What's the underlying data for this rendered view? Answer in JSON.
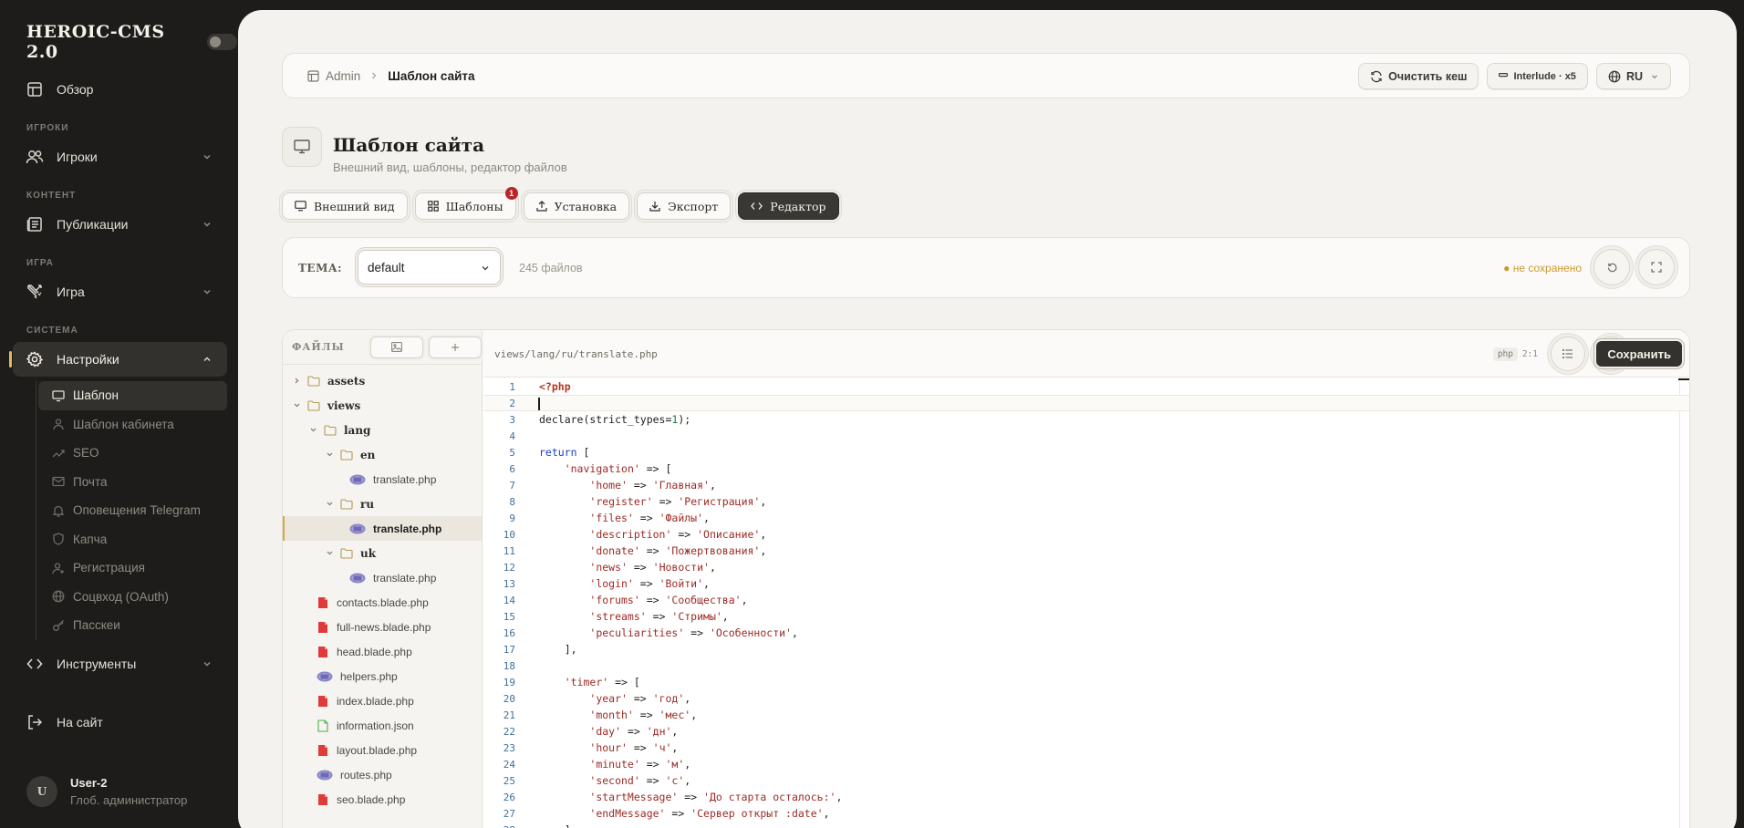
{
  "sidebar": {
    "logo": "HEROIC-CMS 2.0",
    "overview": "Обзор",
    "sections": {
      "players": "ИГРОКИ",
      "content": "КОНТЕНТ",
      "game": "ИГРА",
      "system": "СИСТЕМА"
    },
    "players_item": "Игроки",
    "publications_item": "Публикации",
    "game_item": "Игра",
    "settings_item": "Настройки",
    "settings_sub": [
      "Шаблон",
      "Шаблон кабинета",
      "SEO",
      "Почта",
      "Оповещения Telegram",
      "Капча",
      "Регистрация",
      "Соцвход (OAuth)",
      "Пасскеи"
    ],
    "tools_item": "Инструменты",
    "to_site": "На сайт",
    "user": {
      "initial": "U",
      "name": "User-2",
      "role": "Глоб. администратор"
    }
  },
  "topbar": {
    "crumb_admin": "Admin",
    "crumb_current": "Шаблон сайта",
    "clear_cache": "Очистить кеш",
    "server": "Interlude · x5",
    "language": "RU"
  },
  "page": {
    "title": "Шаблон сайта",
    "subtitle": "Внешний вид, шаблоны, редактор файлов"
  },
  "tabs": {
    "appearance": "Внешний вид",
    "templates": "Шаблоны",
    "templates_badge": "1",
    "install": "Установка",
    "export": "Экспорт",
    "editor": "Редактор"
  },
  "theme_bar": {
    "label": "ТЕМА:",
    "selected": "default",
    "files_count": "245 файлов",
    "status": "● не сохранено"
  },
  "files": {
    "title": "ФАЙЛЫ",
    "tree": [
      {
        "name": "assets",
        "kind": "folder",
        "depth": 0,
        "open": false
      },
      {
        "name": "views",
        "kind": "folder",
        "depth": 0,
        "open": true
      },
      {
        "name": "lang",
        "kind": "folder",
        "depth": 1,
        "open": true
      },
      {
        "name": "en",
        "kind": "folder",
        "depth": 2,
        "open": true
      },
      {
        "name": "translate.php",
        "kind": "php",
        "depth": 3
      },
      {
        "name": "ru",
        "kind": "folder",
        "depth": 2,
        "open": true
      },
      {
        "name": "translate.php",
        "kind": "php",
        "depth": 3,
        "selected": true
      },
      {
        "name": "uk",
        "kind": "folder",
        "depth": 2,
        "open": true
      },
      {
        "name": "translate.php",
        "kind": "php",
        "depth": 3
      },
      {
        "name": "contacts.blade.php",
        "kind": "blade",
        "depth": 1
      },
      {
        "name": "full-news.blade.php",
        "kind": "blade",
        "depth": 1
      },
      {
        "name": "head.blade.php",
        "kind": "blade",
        "depth": 1
      },
      {
        "name": "helpers.php",
        "kind": "php",
        "depth": 1
      },
      {
        "name": "index.blade.php",
        "kind": "blade",
        "depth": 1
      },
      {
        "name": "information.json",
        "kind": "json",
        "depth": 1
      },
      {
        "name": "layout.blade.php",
        "kind": "blade",
        "depth": 1
      },
      {
        "name": "routes.php",
        "kind": "php",
        "depth": 1
      },
      {
        "name": "seo.blade.php",
        "kind": "blade",
        "depth": 1
      }
    ]
  },
  "editor": {
    "path": "views/lang/ru/translate.php",
    "language": "php",
    "cursor": "2:1",
    "save_label": "Сохранить",
    "current_line": 2,
    "lines": [
      [
        [
          "t-tag",
          "<?php"
        ]
      ],
      [],
      [
        [
          "t-fn",
          "declare(strict_types="
        ],
        [
          "t-num",
          "1"
        ],
        [
          "t-fn",
          ");"
        ]
      ],
      [],
      [
        [
          "t-kw",
          "return"
        ],
        [
          "t-fn",
          " ["
        ]
      ],
      [
        [
          "t-fn",
          "    "
        ],
        [
          "t-str",
          "'navigation'"
        ],
        [
          "t-fn",
          " => ["
        ]
      ],
      [
        [
          "t-fn",
          "        "
        ],
        [
          "t-str",
          "'home'"
        ],
        [
          "t-fn",
          " => "
        ],
        [
          "t-str",
          "'Главная'"
        ],
        [
          "t-fn",
          ","
        ]
      ],
      [
        [
          "t-fn",
          "        "
        ],
        [
          "t-str",
          "'register'"
        ],
        [
          "t-fn",
          " => "
        ],
        [
          "t-str",
          "'Регистрация'"
        ],
        [
          "t-fn",
          ","
        ]
      ],
      [
        [
          "t-fn",
          "        "
        ],
        [
          "t-str",
          "'files'"
        ],
        [
          "t-fn",
          " => "
        ],
        [
          "t-str",
          "'Файлы'"
        ],
        [
          "t-fn",
          ","
        ]
      ],
      [
        [
          "t-fn",
          "        "
        ],
        [
          "t-str",
          "'description'"
        ],
        [
          "t-fn",
          " => "
        ],
        [
          "t-str",
          "'Описание'"
        ],
        [
          "t-fn",
          ","
        ]
      ],
      [
        [
          "t-fn",
          "        "
        ],
        [
          "t-str",
          "'donate'"
        ],
        [
          "t-fn",
          " => "
        ],
        [
          "t-str",
          "'Пожертвования'"
        ],
        [
          "t-fn",
          ","
        ]
      ],
      [
        [
          "t-fn",
          "        "
        ],
        [
          "t-str",
          "'news'"
        ],
        [
          "t-fn",
          " => "
        ],
        [
          "t-str",
          "'Новости'"
        ],
        [
          "t-fn",
          ","
        ]
      ],
      [
        [
          "t-fn",
          "        "
        ],
        [
          "t-str",
          "'login'"
        ],
        [
          "t-fn",
          " => "
        ],
        [
          "t-str",
          "'Войти'"
        ],
        [
          "t-fn",
          ","
        ]
      ],
      [
        [
          "t-fn",
          "        "
        ],
        [
          "t-str",
          "'forums'"
        ],
        [
          "t-fn",
          " => "
        ],
        [
          "t-str",
          "'Сообщества'"
        ],
        [
          "t-fn",
          ","
        ]
      ],
      [
        [
          "t-fn",
          "        "
        ],
        [
          "t-str",
          "'streams'"
        ],
        [
          "t-fn",
          " => "
        ],
        [
          "t-str",
          "'Стримы'"
        ],
        [
          "t-fn",
          ","
        ]
      ],
      [
        [
          "t-fn",
          "        "
        ],
        [
          "t-str",
          "'peculiarities'"
        ],
        [
          "t-fn",
          " => "
        ],
        [
          "t-str",
          "'Особенности'"
        ],
        [
          "t-fn",
          ","
        ]
      ],
      [
        [
          "t-fn",
          "    ],"
        ]
      ],
      [],
      [
        [
          "t-fn",
          "    "
        ],
        [
          "t-str",
          "'timer'"
        ],
        [
          "t-fn",
          " => ["
        ]
      ],
      [
        [
          "t-fn",
          "        "
        ],
        [
          "t-str",
          "'year'"
        ],
        [
          "t-fn",
          " => "
        ],
        [
          "t-str",
          "'год'"
        ],
        [
          "t-fn",
          ","
        ]
      ],
      [
        [
          "t-fn",
          "        "
        ],
        [
          "t-str",
          "'month'"
        ],
        [
          "t-fn",
          " => "
        ],
        [
          "t-str",
          "'мес'"
        ],
        [
          "t-fn",
          ","
        ]
      ],
      [
        [
          "t-fn",
          "        "
        ],
        [
          "t-str",
          "'day'"
        ],
        [
          "t-fn",
          " => "
        ],
        [
          "t-str",
          "'дн'"
        ],
        [
          "t-fn",
          ","
        ]
      ],
      [
        [
          "t-fn",
          "        "
        ],
        [
          "t-str",
          "'hour'"
        ],
        [
          "t-fn",
          " => "
        ],
        [
          "t-str",
          "'ч'"
        ],
        [
          "t-fn",
          ","
        ]
      ],
      [
        [
          "t-fn",
          "        "
        ],
        [
          "t-str",
          "'minute'"
        ],
        [
          "t-fn",
          " => "
        ],
        [
          "t-str",
          "'м'"
        ],
        [
          "t-fn",
          ","
        ]
      ],
      [
        [
          "t-fn",
          "        "
        ],
        [
          "t-str",
          "'second'"
        ],
        [
          "t-fn",
          " => "
        ],
        [
          "t-str",
          "'с'"
        ],
        [
          "t-fn",
          ","
        ]
      ],
      [
        [
          "t-fn",
          "        "
        ],
        [
          "t-str",
          "'startMessage'"
        ],
        [
          "t-fn",
          " => "
        ],
        [
          "t-str",
          "'До старта осталось:'"
        ],
        [
          "t-fn",
          ","
        ]
      ],
      [
        [
          "t-fn",
          "        "
        ],
        [
          "t-str",
          "'endMessage'"
        ],
        [
          "t-fn",
          " => "
        ],
        [
          "t-str",
          "'Сервер открыт :date'"
        ],
        [
          "t-fn",
          ","
        ]
      ],
      [
        [
          "t-fn",
          "    ],"
        ]
      ]
    ]
  },
  "colors": {
    "sidebar_bg": "#1d1c1a",
    "main_bg": "#f4f2ee",
    "accent_gold": "#d4a94a",
    "status_unsaved": "#c99a2e",
    "badge_red": "#b8262a",
    "dark_button": "#34322e"
  }
}
